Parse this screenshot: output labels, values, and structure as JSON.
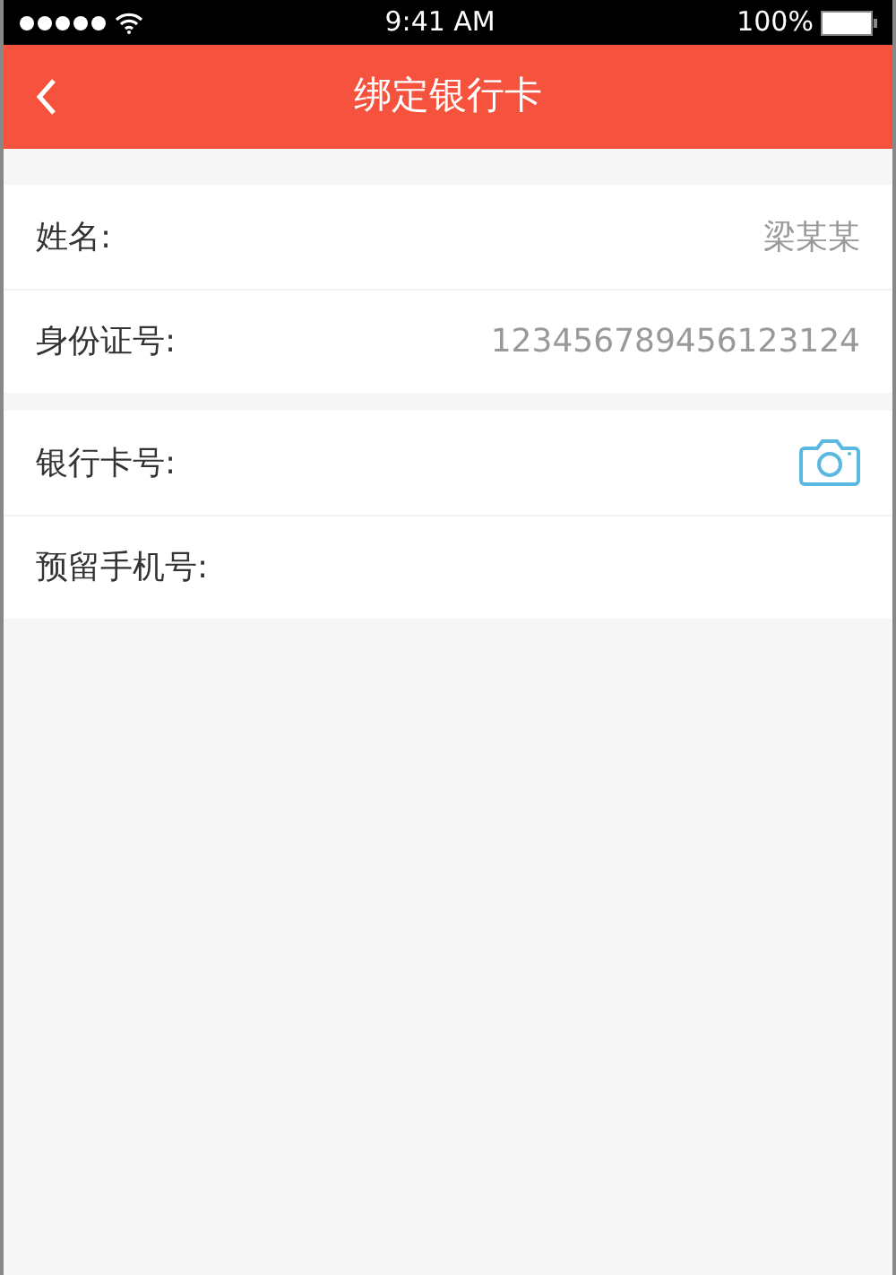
{
  "status_bar": {
    "time": "9:41 AM",
    "battery": "100%"
  },
  "header": {
    "title": "绑定银行卡"
  },
  "groups": [
    {
      "rows": [
        {
          "kind": "value",
          "label": "姓名:",
          "value": "梁某某"
        },
        {
          "kind": "value",
          "label": "身份证号:",
          "value": "123456789456123124"
        }
      ]
    },
    {
      "rows": [
        {
          "kind": "camera",
          "label": "银行卡号:"
        },
        {
          "kind": "input",
          "label": "预留手机号:"
        }
      ]
    }
  ]
}
